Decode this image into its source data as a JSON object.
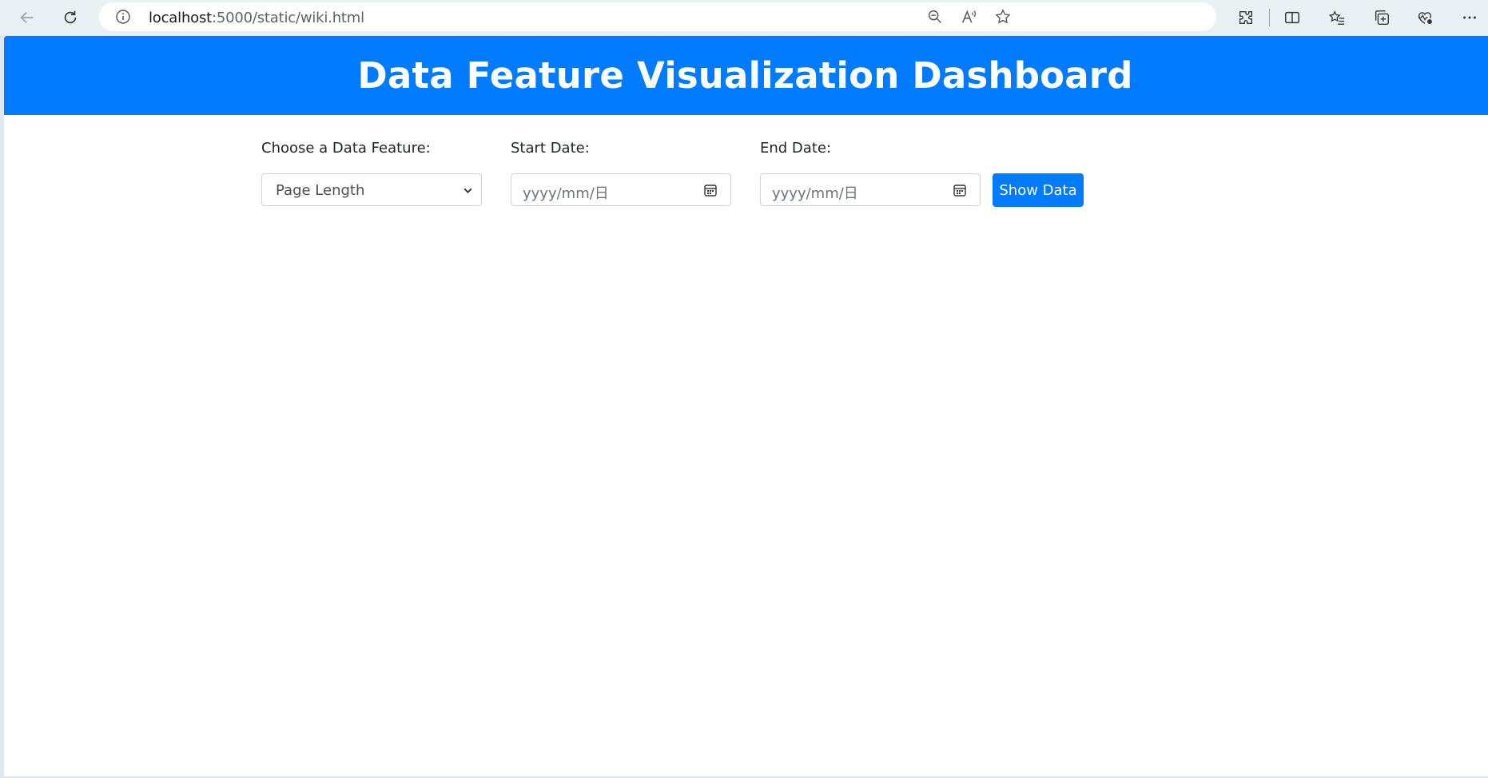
{
  "browser": {
    "url_host": "localhost",
    "url_rest": ":5000/static/wiki.html",
    "icons": [
      "back-icon",
      "refresh-icon",
      "info-icon",
      "zoom-out-icon",
      "read-aloud-icon",
      "favorite-star-icon",
      "extensions-icon",
      "split-screen-icon",
      "favorites-icon",
      "collections-icon",
      "browser-essentials-icon",
      "more-icon"
    ]
  },
  "page": {
    "title": "Data Feature Visualization Dashboard",
    "feature": {
      "label": "Choose a Data Feature:",
      "selected": "Page Length"
    },
    "start_date": {
      "label": "Start Date:",
      "placeholder": "yyyy/mm/日"
    },
    "end_date": {
      "label": "End Date:",
      "placeholder": "yyyy/mm/日"
    },
    "submit_label": "Show Data"
  },
  "colors": {
    "primary": "#007bff",
    "chrome_bg": "#eaf1f4"
  }
}
